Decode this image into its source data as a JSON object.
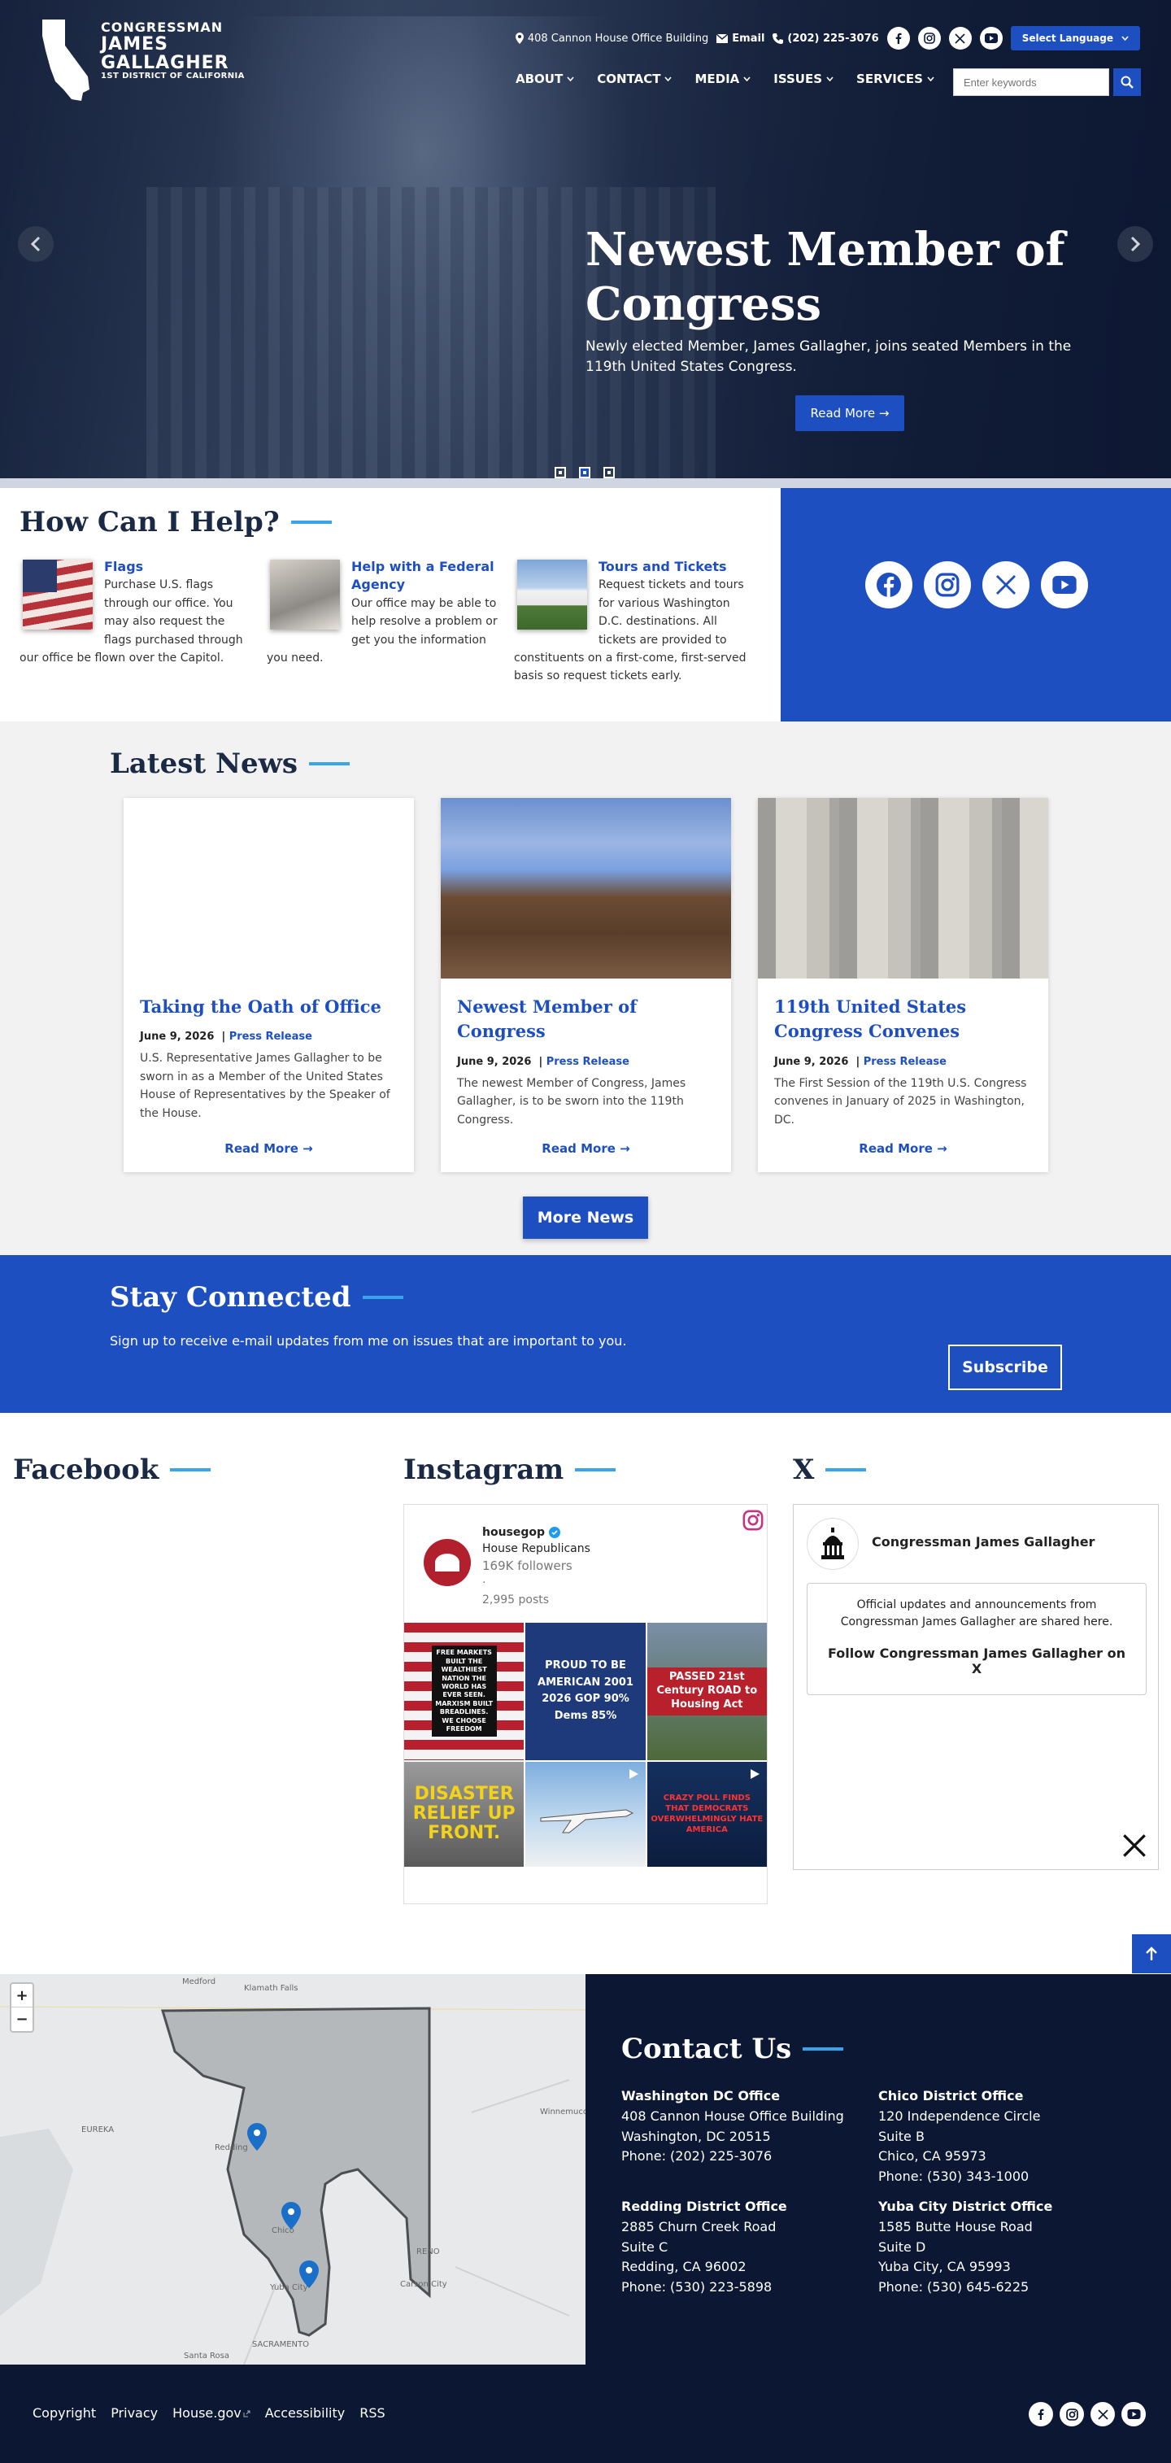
{
  "logo": {
    "line1": "CONGRESSMAN",
    "line2": "JAMES",
    "line3": "GALLAGHER",
    "line4": "1ST DISTRICT OF CALIFORNIA"
  },
  "utility": {
    "address": "408 Cannon House Office Building",
    "email": "Email",
    "phone": "(202) 225-3076",
    "language": "Select Language"
  },
  "nav": [
    "ABOUT",
    "CONTACT",
    "MEDIA",
    "ISSUES",
    "SERVICES"
  ],
  "search": {
    "placeholder": "Enter keywords"
  },
  "hero": {
    "title": "Newest Member of Congress",
    "subtitle": "Newly elected Member, James Gallagher, joins seated Members in the 119th United States Congress.",
    "button": "Read More →"
  },
  "help": {
    "title": "How Can I Help?",
    "items": [
      {
        "title": "Flags",
        "text": "Purchase U.S. flags through our office. You may also request the flags purchased through our office be flown over the Capitol."
      },
      {
        "title": "Help with a Federal Agency",
        "text": "Our office may be able to help resolve a problem or get you the information you need."
      },
      {
        "title": "Tours and Tickets",
        "text": "Request tickets and tours for various Washington D.C. destinations. All tickets are provided to constituents on a first-come, first-served basis so request tickets early."
      }
    ]
  },
  "news": {
    "title": "Latest News",
    "cards": [
      {
        "title": "Taking the Oath of Office",
        "date": "June 9, 2026",
        "type": "Press Release",
        "desc": "U.S. Representative James Gallagher to be sworn in as a Member of the United States House of Representatives by the Speaker of the House.",
        "more": "Read More →"
      },
      {
        "title": "Newest Member of Congress",
        "date": "June 9, 2026",
        "type": "Press Release",
        "desc": "The newest Member of Congress, James Gallagher, is to be sworn into the 119th Congress.",
        "more": "Read More →"
      },
      {
        "title": "119th United States Congress Convenes",
        "date": "June 9, 2026",
        "type": "Press Release",
        "desc": "The First Session of the 119th U.S. Congress convenes in January of 2025 in Washington, DC.",
        "more": "Read More →"
      }
    ],
    "more_button": "More News"
  },
  "stay": {
    "title": "Stay Connected",
    "text": "Sign up to receive e-mail updates from me on issues that are important to you.",
    "button": "Subscribe"
  },
  "feeds": {
    "facebook": "Facebook",
    "instagram": "Instagram",
    "x": "X",
    "ig": {
      "handle": "housegop",
      "name": "House Republicans",
      "followers": "169K followers",
      "dot": "·",
      "posts": "2,995 posts",
      "tiles": [
        "FREE MARKETS BUILT THE WEALTHIEST NATION THE WORLD HAS EVER SEEN. MARXISM BUILT BREADLINES. WE CHOOSE FREEDOM",
        "PROUD TO BE AMERICAN 2001 2026 GOP 90% Dems 85%",
        "PASSED 21st Century ROAD to Housing Act",
        "DISASTER RELIEF UP FRONT.",
        "",
        "CRAZY POLL FINDS THAT DEMOCRATS OVERWHELMINGLY HATE AMERICA"
      ]
    },
    "x_card": {
      "name": "Congressman James Gallagher",
      "text": "Official updates and announcements from Congressman James Gallagher are shared here.",
      "follow": "Follow Congressman James Gallagher on X"
    }
  },
  "map": {
    "labels": [
      "Medford",
      "Klamath Falls",
      "EUREKA",
      "Redding",
      "Chico",
      "Yuba City",
      "RENO",
      "Carson City",
      "Winnemucca",
      "SACRAMENTO",
      "Santa Rosa"
    ],
    "zoom_in": "+",
    "zoom_out": "−"
  },
  "contact": {
    "title": "Contact Us",
    "offices": [
      {
        "name": "Washington DC Office",
        "l1": "408 Cannon House Office Building",
        "l2": "Washington, DC 20515",
        "l3": "Phone: (202) 225-3076",
        "l4": ""
      },
      {
        "name": "Chico District Office",
        "l1": "120 Independence Circle",
        "l2": "Suite B",
        "l3": "Chico, CA 95973",
        "l4": "Phone: (530) 343-1000"
      },
      {
        "name": "Redding District Office",
        "l1": "2885 Churn Creek Road",
        "l2": "Suite C",
        "l3": "Redding, CA 96002",
        "l4": "Phone: (530) 223-5898"
      },
      {
        "name": "Yuba City District Office",
        "l1": "1585 Butte House Road",
        "l2": "Suite D",
        "l3": "Yuba City, CA 95993",
        "l4": "Phone: (530) 645-6225"
      }
    ]
  },
  "footer": {
    "links": [
      "Copyright",
      "Privacy",
      "House.gov",
      "Accessibility",
      "RSS"
    ]
  },
  "colors": {
    "brand_blue": "#1e4fc1",
    "navy": "#0b1733",
    "accent_line": "#3aa4e8"
  }
}
